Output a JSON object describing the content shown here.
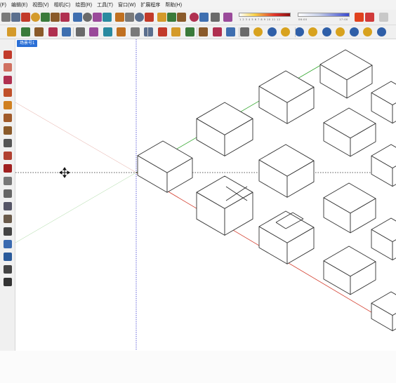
{
  "menu": [
    "(F)",
    "编辑(E)",
    "视图(V)",
    "相机(C)",
    "绘图(R)",
    "工具(T)",
    "窗口(W)",
    "扩展程序",
    "帮助(H)"
  ],
  "scene_tab": "场景号1",
  "toolbar_gradients": {
    "first_ticks": "1 2 3 4 5 6 7 8 9 10 11 12",
    "second_ticks": "06:00 17:00"
  },
  "colors": {
    "red_axis": "#d23a2a",
    "green_axis": "#2fa52a",
    "blue_axis": "#3a3ad0",
    "scene_tab": "#2a6fd6"
  },
  "icons": {
    "toolbar1": [
      "new-icon",
      "open-icon",
      "save-icon",
      "cut-icon",
      "copy-icon",
      "paste-icon",
      "erase-icon",
      "undo-icon",
      "redo-icon",
      "print-icon",
      "model-info-icon",
      "select-icon",
      "component-icon",
      "paint-icon",
      "eraser-icon",
      "orbit-icon",
      "pan-icon",
      "zoom-icon",
      "shadow-icon",
      "fog-icon",
      "sun-icon",
      "3d-warehouse-icon"
    ],
    "toolbar2": [
      "line-icon",
      "pencil-icon",
      "arc-icon",
      "rectangle-icon",
      "push-pull-icon",
      "follow-me-icon",
      "move-icon",
      "rotate-icon",
      "scale-icon",
      "tape-icon",
      "protractor-icon",
      "axes-icon",
      "section-icon",
      "walk-icon",
      "look-around-icon",
      "position-camera-icon",
      "iso-view-icon",
      "top-view-icon",
      "front-view-icon",
      "right-view-icon",
      "back-view-icon",
      "left-view-icon",
      "xray-icon",
      "wireframe-icon",
      "hidden-line-icon",
      "shaded-icon",
      "texture-icon",
      "mono-icon"
    ],
    "left": [
      "select-tool-icon",
      "eraser-tool-icon",
      "freehand-icon",
      "rectangle-tool-icon",
      "circle-tool-icon",
      "arc-tool-icon",
      "pie-icon",
      "move-tool-icon",
      "push-pull-tool-icon",
      "rotate-tool-icon",
      "tape-measure-icon",
      "text-tool-icon",
      "dimension-icon",
      "paint-bucket-icon",
      "orbit-tool-icon",
      "zoom-tool-icon",
      "zoom-extents-icon",
      "walk-tool-icon",
      "position-tool-icon"
    ]
  }
}
